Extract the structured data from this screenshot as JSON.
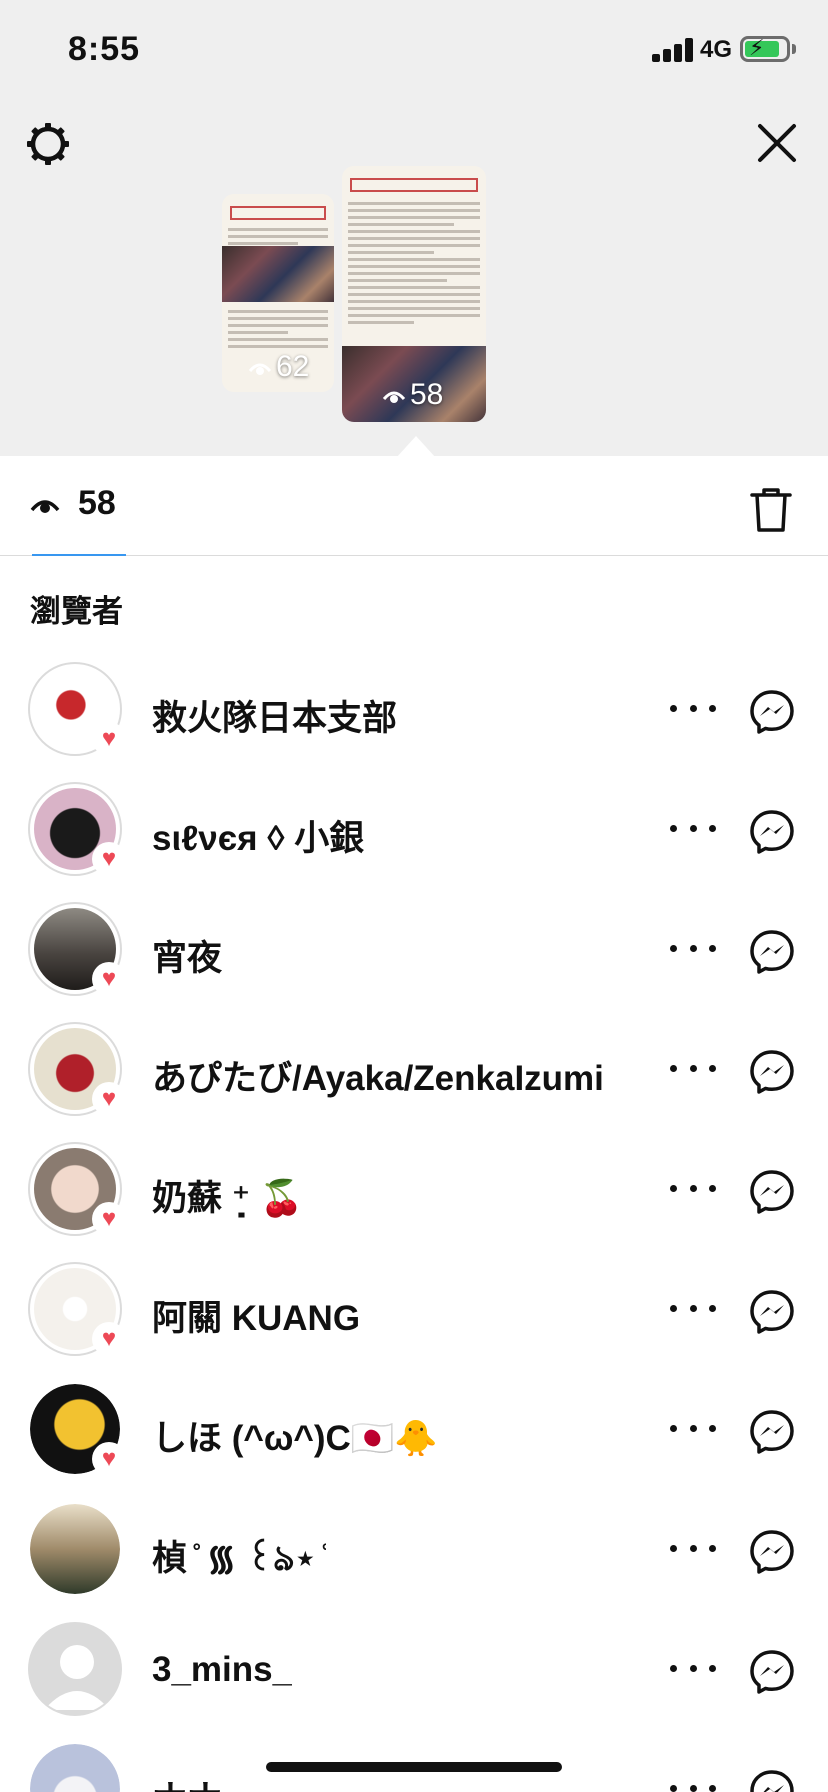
{
  "status_bar": {
    "time": "8:55",
    "network": "4G",
    "battery_level": 0.75,
    "battery_color": "#34c759"
  },
  "header": {
    "settings_icon": "gear-icon",
    "close_icon": "close-icon"
  },
  "stories": [
    {
      "views": "62",
      "icon": "eye-icon"
    },
    {
      "views": "58",
      "icon": "eye-icon",
      "selected": true
    }
  ],
  "tabs": {
    "active_count": "58",
    "active_icon": "eye-icon",
    "delete_icon": "trash-icon",
    "accent_color": "#3897f0"
  },
  "section_title": "瀏覽者",
  "viewers": [
    {
      "name": "救火隊日本支部",
      "liked": true
    },
    {
      "name": "ѕιℓνєя ◊ 小銀",
      "liked": true
    },
    {
      "name": "宵夜",
      "liked": true
    },
    {
      "name": "あぴたび/Ayaka/ZenkaIzumi",
      "liked": true
    },
    {
      "name": "奶蘇 ⁺̣ 🍒",
      "liked": true
    },
    {
      "name": "阿關 KUANG",
      "liked": true
    },
    {
      "name": "しほ (^ω^)C🇯🇵🐥",
      "liked": true
    },
    {
      "name": "楨 ̊ ᯾ ꒰ঌ⋆ ̊",
      "liked": false
    },
    {
      "name": "3_mins_",
      "liked": false
    },
    {
      "name": "ナナ",
      "liked": false
    }
  ],
  "heart_color": "#ed4956"
}
